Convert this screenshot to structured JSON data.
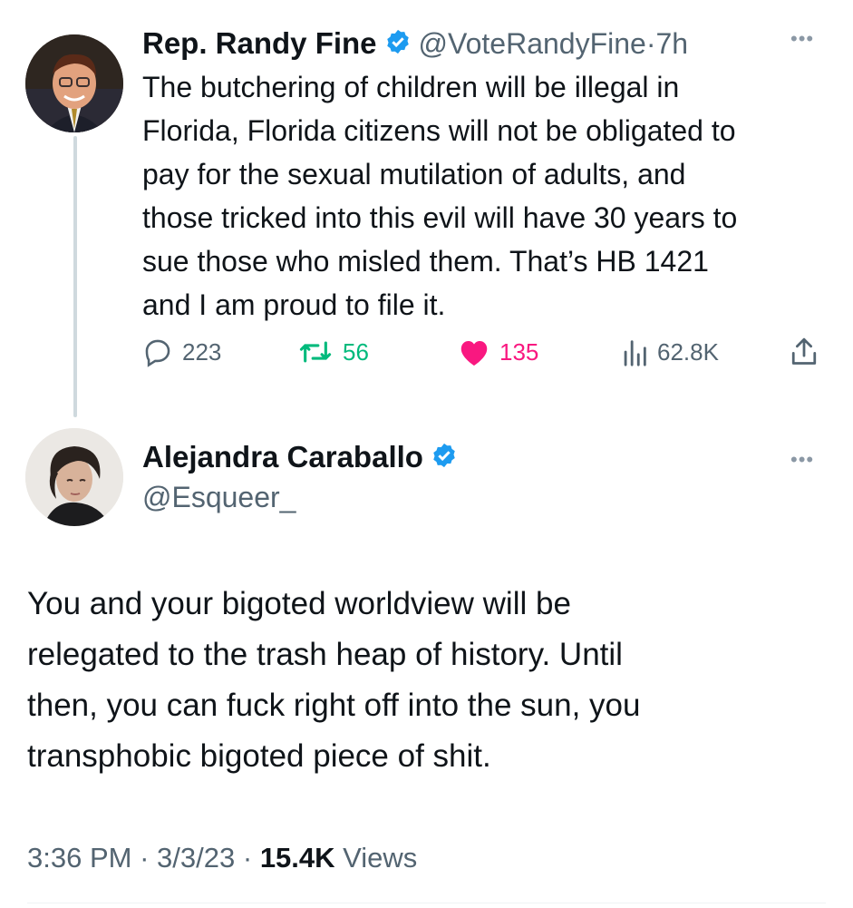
{
  "tweet1": {
    "author_name": "Rep. Randy Fine",
    "handle": "@VoteRandyFine",
    "time": "7h",
    "text_lines": [
      "The butchering of children will be illegal in",
      "Florida, Florida citizens will not be obligated to",
      "pay for the sexual mutilation of adults, and",
      "those tricked into this evil will have 30 years to",
      "sue those who misled them.  That’s HB 1421",
      "and I am proud to file it."
    ],
    "replies": "223",
    "retweets": "56",
    "likes": "135",
    "views": "62.8K",
    "more_icon": "more-dots-icon"
  },
  "tweet2": {
    "author_name": "Alejandra Caraballo",
    "handle": "@Esqueer_",
    "text_lines": [
      "You and your bigoted worldview will be",
      "relegated to the trash heap of history. Until",
      "then, you can fuck right off into the sun, you",
      "transphobic bigoted piece of shit."
    ],
    "time": "3:36 PM",
    "date": "3/3/23",
    "views_count": "15.4K",
    "views_label": "Views"
  },
  "colors": {
    "verified": "#1d9bf0",
    "retweet": "#00ba7c",
    "like": "#f91880",
    "secondary": "#536471",
    "thread_line": "#cfd9de"
  }
}
